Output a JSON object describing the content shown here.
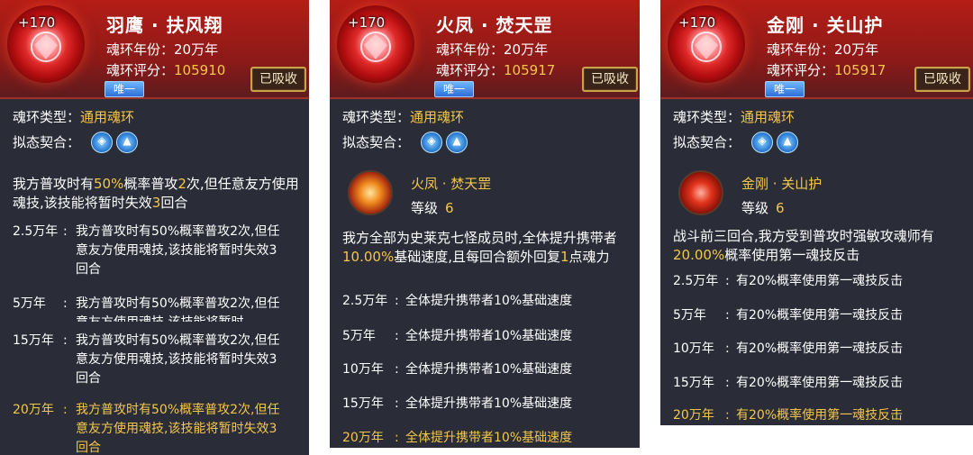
{
  "labels": {
    "year_label": "魂环年份：",
    "score_label": "魂环评分：",
    "type_label": "魂环类型：",
    "fit_label": "拟态契合：",
    "unique_tag": "唯一",
    "absorbed_button": "已吸收",
    "plus_badge": "+170",
    "level_label": "等级"
  },
  "cards": [
    {
      "title": "羽鹰 · 扶风翔",
      "year_value": "20万年",
      "score_value": "105910",
      "type_value": "通用魂环",
      "fit_icons": [
        "shield-icon",
        "mountain-icon"
      ],
      "desc_pre": "我方普攻时有",
      "desc_hl1": "50%",
      "desc_mid": "概率普攻",
      "desc_hl2": "2",
      "desc_mid2": "次,但任意友方使用魂技,该技能将暂时失效",
      "desc_hl3": "3",
      "desc_post": "回合",
      "levels": [
        {
          "year": "2.5万年",
          "text": "我方普攻时有50%概率普攻2次,但任意友方使用魂技,该技能将暂时失效3回合"
        },
        {
          "year": "5万年",
          "text": "我方普攻时有50%概率普攻2次,但任意友方使用魂技,该技能将暂时"
        },
        {
          "year": "15万年",
          "text": "我方普攻时有50%概率普攻2次,但任意友方使用魂技,该技能将暂时失效3回合"
        },
        {
          "year": "20万年",
          "text": "我方普攻时有50%概率普攻2次,但任意友方使用魂技,该技能将暂时失效3回合"
        }
      ]
    },
    {
      "title": "火凤 · 焚天罡",
      "year_value": "20万年",
      "score_value": "105917",
      "type_value": "通用魂环",
      "fit_icons": [
        "shield-icon",
        "mountain-icon"
      ],
      "skill_name": "火凤 · 焚天罡",
      "skill_level": "6",
      "desc_pre": "我方全部为史莱克七怪成员时,全体提升携带者",
      "desc_hl1": "10.00%",
      "desc_mid": "基础速度,且每回合额外回复",
      "desc_hl2": "1",
      "desc_post": "点魂力",
      "levels": [
        {
          "year": "2.5万年",
          "text": "全体提升携带者10%基础速度"
        },
        {
          "year": "5万年",
          "text": "全体提升携带者10%基础速度"
        },
        {
          "year": "10万年",
          "text": "全体提升携带者10%基础速度"
        },
        {
          "year": "15万年",
          "text": "全体提升携带者10%基础速度"
        },
        {
          "year": "20万年",
          "text": "全体提升携带者10%基础速度"
        }
      ]
    },
    {
      "title": "金刚 · 关山护",
      "year_value": "20万年",
      "score_value": "105917",
      "type_value": "通用魂环",
      "fit_icons": [
        "shield-icon",
        "mountain-icon"
      ],
      "skill_name": "金刚 · 关山护",
      "skill_level": "6",
      "desc_pre": "战斗前三回合,我方受到普攻时强敏攻魂师有",
      "desc_hl1": "20.00%",
      "desc_post": "概率使用第一魂技反击",
      "levels": [
        {
          "year": "2.5万年",
          "text": "有20%概率使用第一魂技反击"
        },
        {
          "year": "5万年",
          "text": "有20%概率使用第一魂技反击"
        },
        {
          "year": "10万年",
          "text": "有20%概率使用第一魂技反击"
        },
        {
          "year": "15万年",
          "text": "有20%概率使用第一魂技反击"
        },
        {
          "year": "20万年",
          "text": "有20%概率使用第一魂技反击"
        }
      ]
    }
  ]
}
